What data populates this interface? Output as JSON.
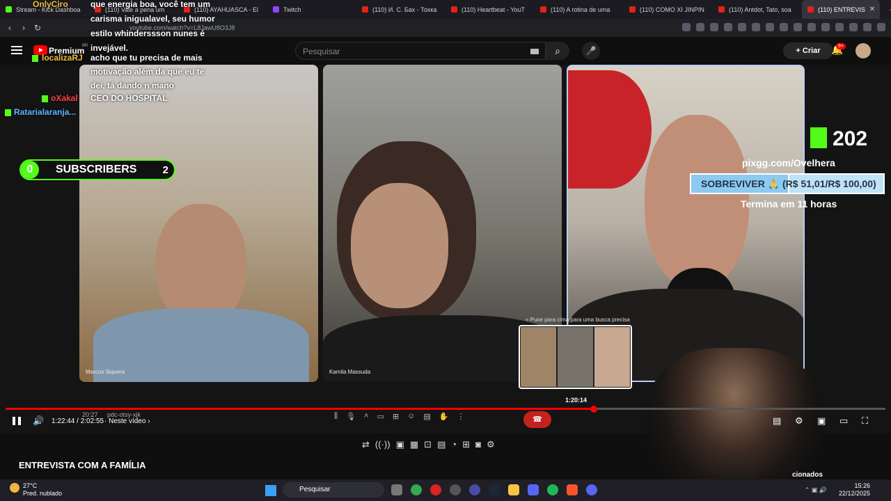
{
  "tabs": [
    {
      "label": "Stream - Kick Dashboa"
    },
    {
      "label": "(110) Vale a pena um"
    },
    {
      "label": "(110) AYAHUASCA - El"
    },
    {
      "label": "Twitch"
    },
    {
      "label": "(110) И. С. Бах - Тохка"
    },
    {
      "label": "(110) Heartbeat - YouT"
    },
    {
      "label": "(110) A rotina de uma"
    },
    {
      "label": "(110) COMO XI JINPIN"
    },
    {
      "label": "(110) Antdot, Tato, soa"
    },
    {
      "label": "(110) ENTREVIS"
    }
  ],
  "address": {
    "url": "youtube.com/watch?v=L8JawU8O3J8"
  },
  "youtube": {
    "brand": "Premium",
    "region": "BR",
    "search_placeholder": "Pesquisar",
    "create_label": "Criar",
    "notif_count": "9+"
  },
  "chat": [
    {
      "user": "OnlyCiro",
      "text": "que energia boa, você tem um carisma inigualavel, seu humor estilo whinderssson nunes é invejável."
    },
    {
      "user": "localizaRJ",
      "text": "acho que tu precisa de mais motivação além da que eu te dei, tá dando n mano"
    },
    {
      "user": "oXakal",
      "text": "CEO DO HOSPITAL"
    },
    {
      "user": "Ratarialaranja...",
      "text": ""
    }
  ],
  "overlay": {
    "subs_left": "0",
    "subs_label": "SUBSCRIBERS",
    "subs_right": "2",
    "kick_count": "202",
    "pix_url": "pixgg.com/Ovelhera",
    "goal_text": "SOBREVIVER 🙏 (R$ 51,01/R$ 100,00)",
    "goal_progress": 0.51,
    "goal_ends": "Termina em 11 horas"
  },
  "participants": [
    {
      "name": "Marcos Siquera"
    },
    {
      "name": "Kamila Massuda"
    }
  ],
  "preview": {
    "hint": "≈ Puxe para cima para uma busca precisa",
    "time": "1:20:14"
  },
  "player": {
    "current": "1:22:44",
    "total": "2:02:55",
    "next_label": "Neste vídeo",
    "meet_time": "20:27",
    "meet_code": "pdc-otsy-xjk",
    "progress": 0.67
  },
  "video_title": "ENTREVISTA COM A FAMÍLIA",
  "related_label": "cionados",
  "taskbar": {
    "temp": "27°C",
    "weather": "Pred. nublado",
    "search": "Pesquisar",
    "time": "15:26",
    "date": "22/12/2025"
  }
}
